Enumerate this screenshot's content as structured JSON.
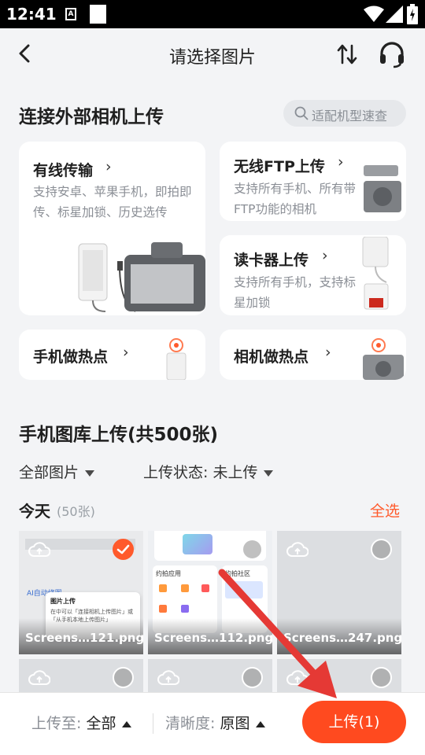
{
  "status_bar": {
    "time": "12:41",
    "notif_letter": "A"
  },
  "header": {
    "title": "请选择图片"
  },
  "external": {
    "title": "连接外部相机上传",
    "search_placeholder": "适配机型速查",
    "cards": [
      {
        "title": "有线传输",
        "desc": "支持安卓、苹果手机，即拍即传、标星加锁、历史选传"
      },
      {
        "title": "无线FTP上传",
        "desc": "支持所有手机、所有带FTP功能的相机"
      },
      {
        "title": "读卡器上传",
        "desc": "支持所有手机，支持标星加锁"
      },
      {
        "title": "手机做热点",
        "desc": ""
      },
      {
        "title": "相机做热点",
        "desc": ""
      }
    ]
  },
  "gallery": {
    "title": "手机图库上传(共500张)",
    "filter_all": "全部图片",
    "filter_status": "上传状态: 未上传",
    "group_label": "今天",
    "group_count": "(50张)",
    "select_all": "全选",
    "thumbs": [
      {
        "name": "Screens…121.png",
        "selected": true
      },
      {
        "name": "Screens…112.png",
        "selected": false
      },
      {
        "name": "Screens…247.png",
        "selected": false
      },
      {
        "name": "",
        "selected": false
      },
      {
        "name": "",
        "selected": false
      },
      {
        "name": "",
        "selected": false
      }
    ],
    "thumb1_popup_title": "图片上传",
    "thumb1_popup_text": "在中可以「连接相机上传图片」或「从手机本地上传图片」",
    "thumb1_ai": "AI自动修图",
    "thumb2_label1": "约拍应用",
    "thumb2_label2": "约拍社区"
  },
  "bottom_bar": {
    "dest_label": "上传至:",
    "dest_value": "全部",
    "quality_label": "清晰度:",
    "quality_value": "原图",
    "upload_button": "上传(1)"
  },
  "colors": {
    "accent": "#ff4a1f",
    "background": "#f3f4f6"
  }
}
